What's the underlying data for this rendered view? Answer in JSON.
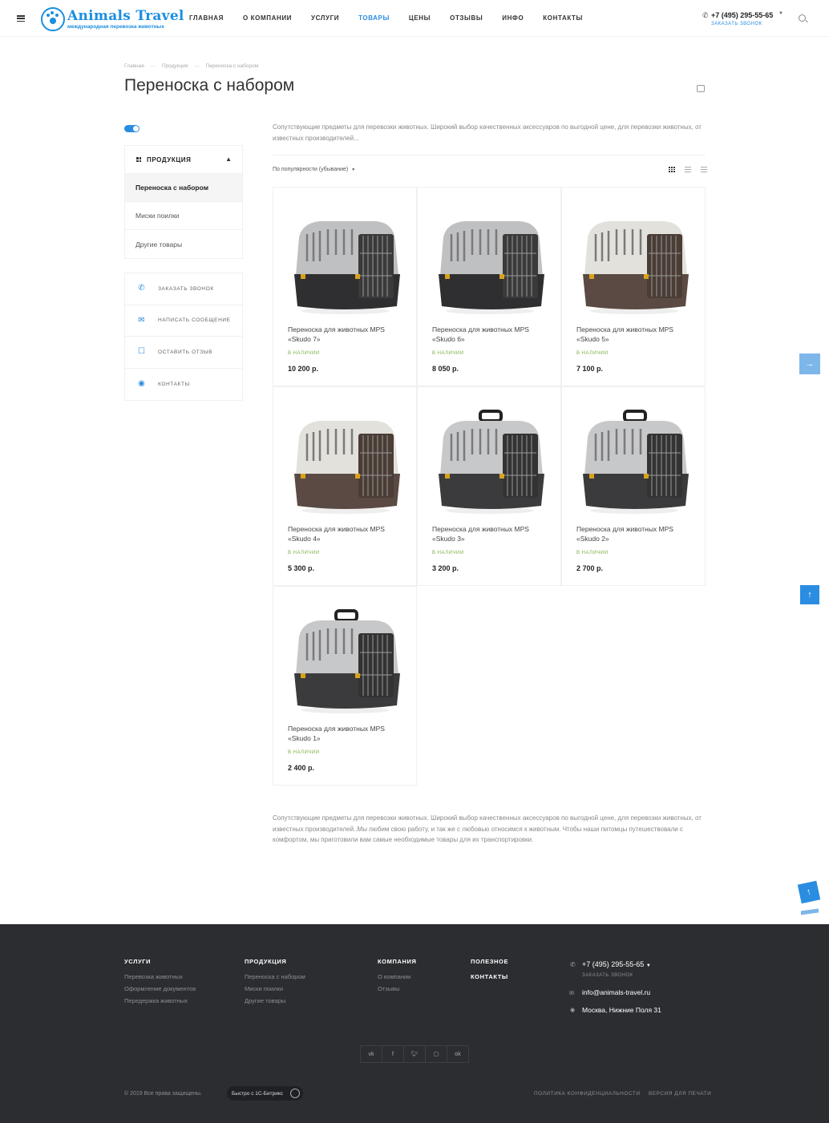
{
  "header": {
    "logo_title": "Animals Travel",
    "logo_subtitle": "международная перевозка животных",
    "nav": [
      {
        "label": "Главная",
        "active": false
      },
      {
        "label": "О компании",
        "active": false
      },
      {
        "label": "Услуги",
        "active": false
      },
      {
        "label": "Товары",
        "active": true
      },
      {
        "label": "Цены",
        "active": false
      },
      {
        "label": "Отзывы",
        "active": false
      },
      {
        "label": "Инфо",
        "active": false
      },
      {
        "label": "Контакты",
        "active": false
      }
    ],
    "phone": "+7 (495) 295-55-65",
    "callback": "Заказать звонок"
  },
  "breadcrumb": [
    "Главная",
    "Продукция",
    "Переноска с набором"
  ],
  "breadcrumb_separator": "—",
  "page_title": "Переноска с набором",
  "sidebar": {
    "heading": "Продукция",
    "items": [
      {
        "label": "Переноска с набором",
        "active": true
      },
      {
        "label": "Миски поилки",
        "active": false
      },
      {
        "label": "Другие товары",
        "active": false
      }
    ],
    "actions": [
      {
        "label": "Заказать звонок",
        "icon": "phone-icon"
      },
      {
        "label": "Написать сообщение",
        "icon": "mail-icon"
      },
      {
        "label": "Оставить отзыв",
        "icon": "chat-icon"
      },
      {
        "label": "Контакты",
        "icon": "location-icon"
      }
    ]
  },
  "intro_text": "Сопутствующие предметы для перевозки животных. Широкий выбор качественных аксессуаров по выгодной цене, для перевозки животных, от известных производителей...",
  "sort_label": "По популярности (убывание)",
  "products": [
    {
      "name": "Переноска для животных MPS «Skudo 7»",
      "stock": "В наличии",
      "price": "10 200 р.",
      "style": "gray"
    },
    {
      "name": "Переноска для животных MPS «Skudo 6»",
      "stock": "В наличии",
      "price": "8 050 р.",
      "style": "gray"
    },
    {
      "name": "Переноска для животных MPS «Skudo 5»",
      "stock": "В наличии",
      "price": "7 100 р.",
      "style": "brown"
    },
    {
      "name": "Переноска для животных MPS «Skudo 4»",
      "stock": "В наличии",
      "price": "5 300 р.",
      "style": "brown"
    },
    {
      "name": "Переноска для животных MPS «Skudo 3»",
      "stock": "В наличии",
      "price": "3 200 р.",
      "style": "handle"
    },
    {
      "name": "Переноска для животных MPS «Skudo 2»",
      "stock": "В наличии",
      "price": "2 700 р.",
      "style": "handle"
    },
    {
      "name": "Переноска для животных MPS «Skudo 1»",
      "stock": "В наличии",
      "price": "2 400 р.",
      "style": "handle"
    }
  ],
  "bottom_text": "Сопутствующие предметы для перевозки животных. Широкий выбор качественных аксессуаров по выгодной цене, для перевозки животных, от известных производителей..Мы любим свою работу, и так же с любовью относимся к животным. Чтобы наши питомцы  путешествовали с комфортом, мы приготовили вам самые необходимые товары для их транспортировки.",
  "footer": {
    "cols": [
      {
        "heading": "Услуги",
        "links": [
          "Перевозка животных",
          "Оформление документов",
          "Передержка животных"
        ]
      },
      {
        "heading": "Продукция",
        "links": [
          "Переноска с набором",
          "Миски поилки",
          "Другие товары"
        ]
      },
      {
        "heading": "Компания",
        "links": [
          "О компании",
          "Отзывы"
        ]
      },
      {
        "heading": "Полезное",
        "links": []
      },
      {
        "heading": "Контакты",
        "links": []
      }
    ],
    "phone": "+7 (495) 295-55-65",
    "callback": "Заказать звонок",
    "email": "info@animals-travel.ru",
    "address": "Москва, Нижние Поля 31",
    "socials": [
      "vk",
      "f",
      "t",
      "ig",
      "ok"
    ],
    "copyright": "© 2019 Все права защищены.",
    "bitrix": "Быстро с 1С-Битрикс",
    "policy": "Политика конфиденциальности",
    "print_version": "Версия для печати"
  },
  "colors": {
    "accent": "#2a8de1",
    "stock": "#7fb04a",
    "footer_bg": "#2c2d31"
  }
}
